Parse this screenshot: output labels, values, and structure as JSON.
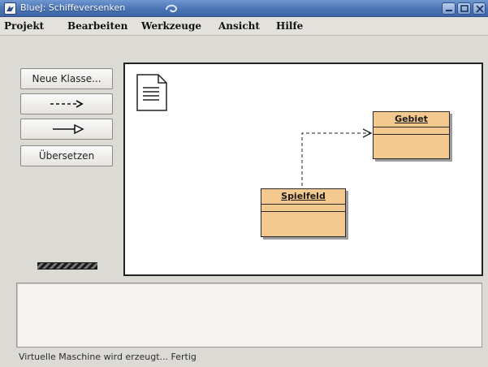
{
  "window": {
    "app_name": "BlueJ:",
    "project_name": "Schiffeversenken"
  },
  "menu": {
    "items": [
      {
        "label": "Projekt"
      },
      {
        "label": "Bearbeiten"
      },
      {
        "label": "Werkzeuge"
      },
      {
        "label": "Ansicht"
      },
      {
        "label": "Hilfe"
      }
    ]
  },
  "toolbar": {
    "new_class_label": "Neue Klasse...",
    "uses_arrow_label": "--->",
    "inherits_arrow_label": "—▷",
    "compile_label": "Übersetzen"
  },
  "diagram": {
    "classes": [
      {
        "name": "Gebiet"
      },
      {
        "name": "Spielfeld"
      }
    ],
    "relation": "Spielfeld uses Gebiet (dashed dependency arrow)"
  },
  "status": {
    "text": "Virtuelle Maschine wird erzeugt... Fertig"
  },
  "colors": {
    "titlebar": "#4a73b4",
    "class_fill": "#f4c990",
    "canvas_bg": "#ffffff",
    "window_bg": "#dcdad5"
  }
}
